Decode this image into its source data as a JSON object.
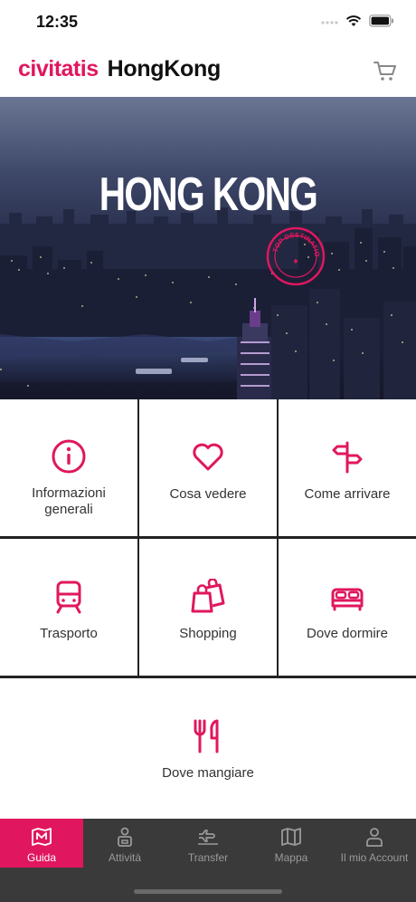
{
  "status_bar": {
    "time": "12:35"
  },
  "header": {
    "brand": "civitatis",
    "city": "HongKong"
  },
  "hero": {
    "title": "HONG KONG",
    "badge_text": "TOP DESTINATION"
  },
  "menu": {
    "items": [
      {
        "label": "Informazioni\ngenerali",
        "icon": "info-icon"
      },
      {
        "label": "Cosa vedere",
        "icon": "heart-icon"
      },
      {
        "label": "Come arrivare",
        "icon": "signpost-icon"
      },
      {
        "label": "Trasporto",
        "icon": "train-icon"
      },
      {
        "label": "Shopping",
        "icon": "shopping-bags-icon"
      },
      {
        "label": "Dove dormire",
        "icon": "bed-icon"
      },
      {
        "label": "Dove mangiare",
        "icon": "fork-knife-icon"
      }
    ]
  },
  "tabbar": {
    "tabs": [
      {
        "label": "Guida",
        "icon": "map-guide-icon",
        "active": true
      },
      {
        "label": "Attività",
        "icon": "person-activity-icon",
        "active": false
      },
      {
        "label": "Transfer",
        "icon": "plane-icon",
        "active": false
      },
      {
        "label": "Mappa",
        "icon": "map-icon",
        "active": false
      },
      {
        "label": "Il mio Account",
        "icon": "user-icon",
        "active": false
      }
    ]
  },
  "colors": {
    "accent": "#e0175e",
    "tabbar_bg": "#3a3a3a",
    "tab_inactive": "#9a9a9a"
  }
}
